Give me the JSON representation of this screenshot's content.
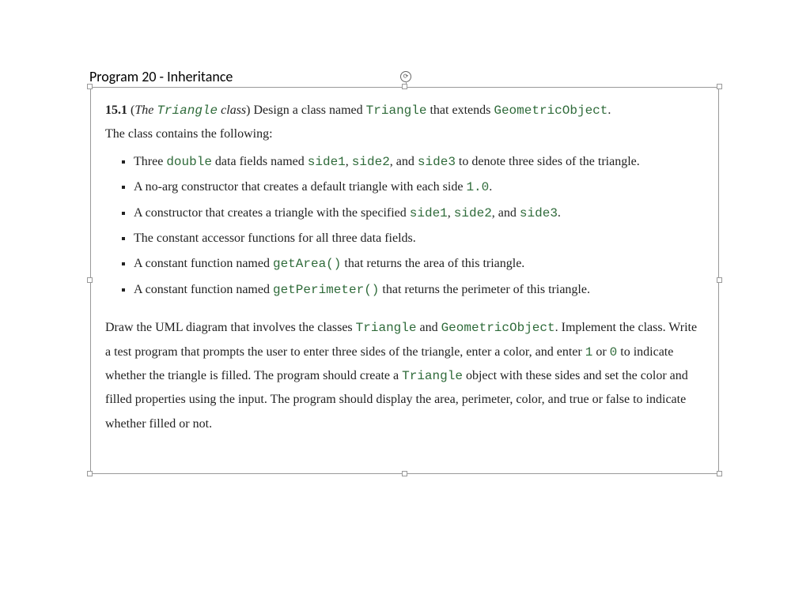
{
  "title": "Program 20 - Inheritance",
  "exercise_number": "15.1",
  "intro": {
    "prefix_open": "(",
    "ital_word": "The",
    "code_class": "Triangle",
    "ital_word2": "class",
    "prefix_close": ")",
    "text1": " Design a class named ",
    "code1": "Triangle",
    "text2": " that extends ",
    "code2": "GeometricObject",
    "period": ".",
    "line2": "The class contains the following:"
  },
  "bullets": [
    {
      "t0": "Three ",
      "c0": "double",
      "t1": " data fields named ",
      "c1": "side1",
      "s1": ", ",
      "c2": "side2",
      "s2": ", and ",
      "c3": "side3",
      "t2": " to denote three sides of the triangle."
    },
    {
      "t0": "A no-arg constructor that creates a default triangle with each side ",
      "c0": "1.0",
      "t1": "."
    },
    {
      "t0": "A constructor that creates a triangle with the specified ",
      "c0": "side1",
      "s0": ", ",
      "c1": "side2",
      "s1": ", and ",
      "c2": "side3",
      "t1": "."
    },
    {
      "t0": "The constant accessor functions for all three data fields."
    },
    {
      "t0": "A constant function named ",
      "c0": "getArea()",
      "t1": " that returns the area of this triangle."
    },
    {
      "t0": "A constant function named ",
      "c0": "getPerimeter()",
      "t1": " that returns the perimeter of this triangle."
    }
  ],
  "para": {
    "t0": "Draw the UML diagram that involves the classes ",
    "c0": "Triangle",
    "t1": " and ",
    "c1": "GeometricObject",
    "t2": ". Implement the class. Write a test program that prompts the user to enter three sides of the triangle, enter a color, and enter ",
    "c2": "1",
    "t3": " or ",
    "c3": "0",
    "t4": " to indicate whether the triangle is filled. The program should create a ",
    "c4": "Triangle",
    "t5": " object with these sides and set the color and filled properties using the input. The program should display the area, perimeter, color, and true or false to indicate whether filled or not."
  }
}
